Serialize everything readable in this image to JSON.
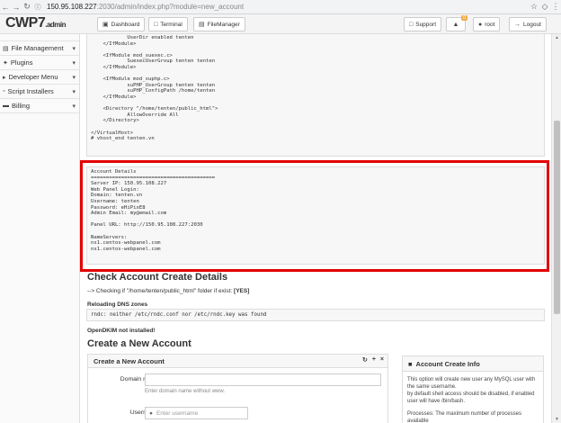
{
  "browser": {
    "url_host": "150.95.108.227",
    "url_path": ":2030/admin/index.php?module=new_account"
  },
  "header": {
    "logo_main": "CWP7",
    "logo_sub": ".admin",
    "buttons": {
      "dashboard": "Dashboard",
      "terminal": "Terminal",
      "filemanager": "FileManager",
      "support": "Support",
      "notifications_count": "0",
      "user": "root",
      "logout": "Logout"
    }
  },
  "sidebar": {
    "items": [
      {
        "label": "File Management"
      },
      {
        "label": "Plugins"
      },
      {
        "label": "Developer Menu"
      },
      {
        "label": "Script Installers"
      },
      {
        "label": "Billing"
      }
    ]
  },
  "vhost_config": "            UserDir enabled tenten\n    </IfModule>\n\n    <IfModule mod_suexec.c>\n            SuexecUserGroup tenten tenten\n    </IfModule>\n\n    <IfModule mod_suphp.c>\n            suPHP_UserGroup tenten tenten\n            suPHP_ConfigPath /home/tenten\n    </IfModule>\n\n    <Directory \"/home/tenten/public_html\">\n            AllowOverride All\n    </Directory>\n\n</VirtualHost>\n# vhost_end tenten.vn",
  "account_details": "Account Details\n=========================================\nServer IP: 150.95.108.227\nWeb Panel Login:\nDomain: tenten.vn\nUsername: tenten\nPassword: eHiPixE8\nAdmin Email: my@email.com\n\nPanel URL: http://150.95.108.227:2030\n\nNameServers:\nns1.centos-webpanel.com\nns1.centos-webpanel.com",
  "check_account": {
    "title": "Check Account Create Details",
    "folder_check": "--> Checking if \"/home/tenten/public_html\" folder if exist:",
    "folder_check_result": "[YES]",
    "dns_title": "Reloading DNS zones",
    "rndc_output": "rndc: neither /etc/rndc.conf nor /etc/rndc.key was found",
    "dkim": "OpenDKIM not installed!"
  },
  "create_new": {
    "title": "Create a New Account",
    "panel_title": "Create a New Account",
    "domain_label": "Domain name:",
    "domain_help": "Enter domain name without www.",
    "username_label": "Username:",
    "username_placeholder": "Enter username"
  },
  "info_panel": {
    "title": "Account Create Info",
    "text1": "This option will create new user any MySQL user with the same username.",
    "text2": "by default shell access should be disabled, if enabled user will have /bin/bash.",
    "text3": "Processes: The maximum number of processes available"
  }
}
